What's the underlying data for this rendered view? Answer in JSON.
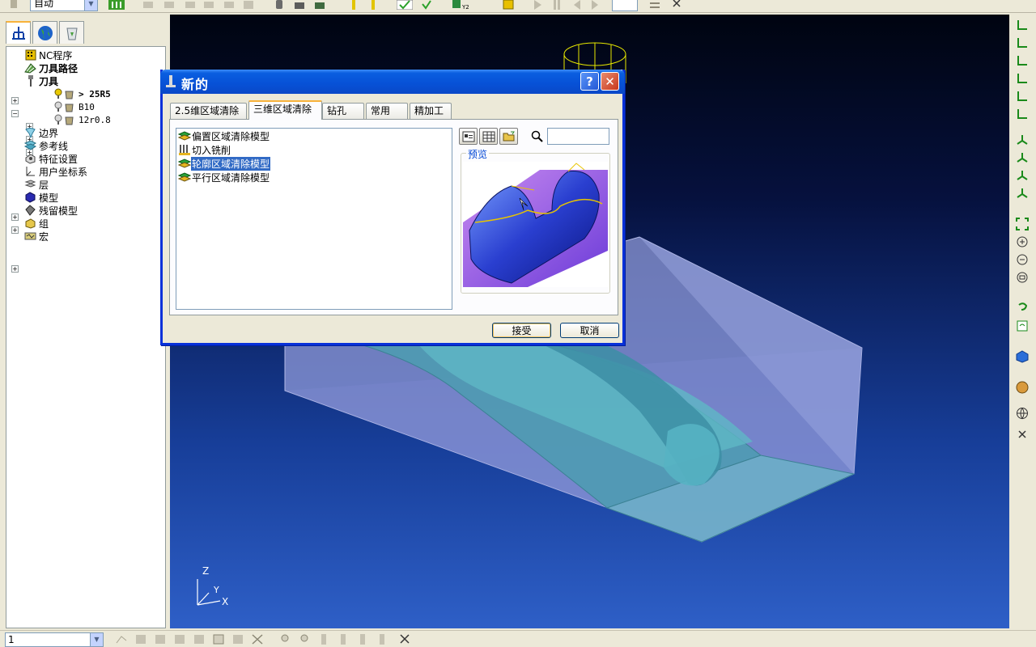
{
  "toolbar": {
    "mode_value": "自动"
  },
  "explorer": {
    "tabs": [
      {
        "icon": "explorer-icon"
      },
      {
        "icon": "globe-icon"
      },
      {
        "icon": "recycle-bin-icon"
      }
    ],
    "tree": [
      {
        "label": "NC程序",
        "icon": "nc-program-icon",
        "expander": false,
        "bold": false
      },
      {
        "label": "刀具路径",
        "icon": "toolpath-icon",
        "expander": "+",
        "bold": true
      },
      {
        "label": "刀具",
        "icon": "tool-icon",
        "expander": "-",
        "bold": true
      },
      {
        "label": "> 25R5",
        "icon": "tool-item-icon",
        "expander": "+",
        "bold": true,
        "child": true
      },
      {
        "label": "B10",
        "icon": "tool-item-icon",
        "expander": "+",
        "bold": false,
        "child": true
      },
      {
        "label": "12r0.8",
        "icon": "tool-item-icon",
        "expander": "+",
        "bold": false,
        "child": true
      },
      {
        "label": "边界",
        "icon": "boundary-icon",
        "expander": false,
        "bold": false
      },
      {
        "label": "参考线",
        "icon": "pattern-icon",
        "expander": false,
        "bold": false
      },
      {
        "label": "特征设置",
        "icon": "feature-icon",
        "expander": false,
        "bold": false
      },
      {
        "label": "用户坐标系",
        "icon": "workplane-icon",
        "expander": false,
        "bold": false
      },
      {
        "label": "层",
        "icon": "layer-icon",
        "expander": "+",
        "bold": false
      },
      {
        "label": "模型",
        "icon": "model-icon",
        "expander": "+",
        "bold": false
      },
      {
        "label": "残留模型",
        "icon": "stock-model-icon",
        "expander": false,
        "bold": false
      },
      {
        "label": "组",
        "icon": "group-icon",
        "expander": false,
        "bold": false
      },
      {
        "label": "宏",
        "icon": "macro-icon",
        "expander": "+",
        "bold": false
      }
    ]
  },
  "viewport": {
    "axis_z": "Z",
    "axis_y": "Y",
    "axis_x": "X"
  },
  "dialog": {
    "title": "新的",
    "tabs": [
      "2.5维区域清除",
      "三维区域清除",
      "钻孔",
      "常用",
      "精加工"
    ],
    "active_tab": 1,
    "items": [
      "偏置区域清除模型",
      "切入铣削",
      "轮廓区域清除模型",
      "平行区域清除模型"
    ],
    "selected_item": 2,
    "preview_label": "预览",
    "search_value": "",
    "accept_label": "接受",
    "cancel_label": "取消"
  },
  "bottom": {
    "select_value": "1"
  },
  "colors": {
    "title_bar": "#0a5ee0",
    "selection": "#316ac5",
    "viewport_top": "#000410",
    "viewport_bottom": "#2e5fc7"
  }
}
